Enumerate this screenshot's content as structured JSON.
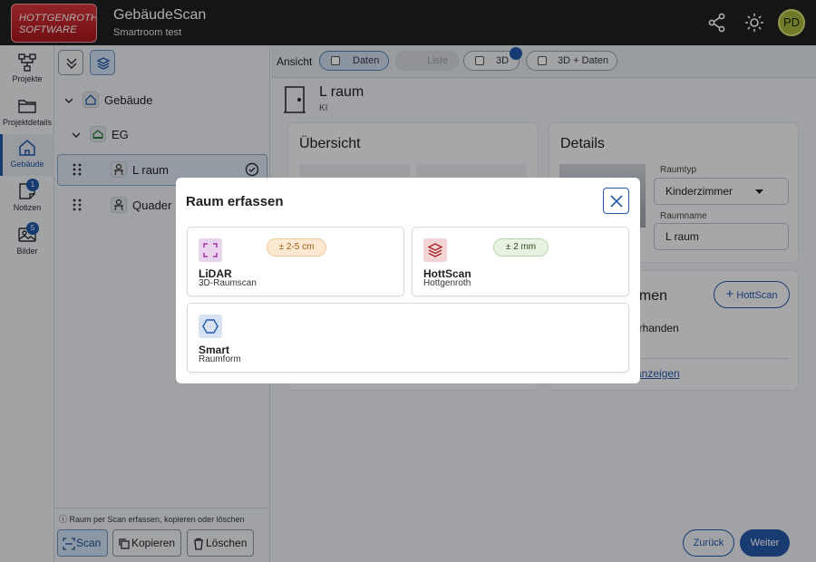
{
  "header": {
    "logo_line1": "HOTTGENROTH",
    "logo_line2": "SOFTWARE",
    "title": "GebäudeScan",
    "subtitle": "Smartroom test",
    "avatar_initials": "PD",
    "icons": [
      "share-icon",
      "brightness-icon"
    ]
  },
  "rail": {
    "items": [
      {
        "label": "Projekte",
        "icon": "sitemap-icon"
      },
      {
        "label": "Projektdetails",
        "icon": "folder-icon"
      },
      {
        "label": "Gebäude",
        "icon": "home-icon",
        "active": true
      },
      {
        "label": "Notizen",
        "icon": "note-icon",
        "badge": "1"
      },
      {
        "label": "Bilder",
        "icon": "image-icon",
        "badge": "5"
      }
    ]
  },
  "tree": {
    "building": "Gebäude",
    "floor": "EG",
    "rooms": [
      "L raum",
      "Quader R"
    ],
    "hint": "Raum per Scan erfassen, kopieren oder löschen",
    "actions": {
      "scan": "Scan",
      "copy": "Kopieren",
      "delete": "Löschen"
    }
  },
  "viewbar": {
    "label": "Ansicht",
    "chips": [
      "Daten",
      "Liste",
      "3D",
      "3D + Daten"
    ]
  },
  "room": {
    "title": "L raum",
    "subtitle": "KI"
  },
  "overview": {
    "title": "Übersicht"
  },
  "details": {
    "title": "Details",
    "room_type_label": "Raumtyp",
    "room_type_value": "Kinderzimmer",
    "room_name_label": "Raumname",
    "room_name_value": "L raum"
  },
  "scan_card": {
    "title_partial": "amen",
    "hottscan_btn": "HottScan",
    "text_partial": "orhanden",
    "link_partial": "anzeigen"
  },
  "footer": {
    "back": "Zurück",
    "next": "Weiter"
  },
  "dialog": {
    "title": "Raum erfassen",
    "options": [
      {
        "name": "LiDAR",
        "desc": "3D-Raumscan",
        "accuracy": "± 2-5 cm",
        "icon": "scan-frame-icon"
      },
      {
        "name": "HottScan",
        "desc": "Hottgenroth",
        "accuracy": "± 2 mm",
        "icon": "layers-icon"
      },
      {
        "name": "Smart",
        "desc": "Raumform",
        "icon": "hexagon-icon"
      }
    ]
  },
  "colors": {
    "accent": "#2458a8",
    "brand": "#c0262c"
  }
}
